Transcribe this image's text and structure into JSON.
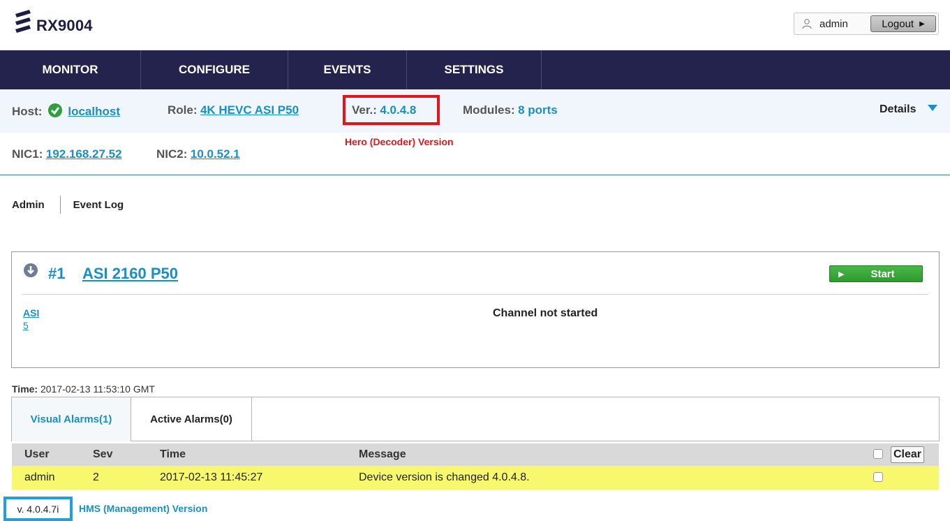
{
  "header": {
    "logo_text": "RX9004",
    "user_name": "admin",
    "logout_label": "Logout",
    "user_icon": "user-icon",
    "logout_arrow_icon": "caret-right-icon"
  },
  "nav": {
    "items": [
      {
        "label": "MONITOR"
      },
      {
        "label": "CONFIGURE"
      },
      {
        "label": "EVENTS"
      },
      {
        "label": "SETTINGS"
      }
    ]
  },
  "info": {
    "host_label": "Host:",
    "host_value": "localhost",
    "role_label": "Role:",
    "role_value": "4K HEVC ASI P50",
    "ver_label": "Ver.:",
    "ver_value": "4.0.4.8",
    "modules_label": "Modules:",
    "modules_value": "8 ports",
    "details_label": "Details",
    "nic1_label": "NIC1:",
    "nic1_value": "192.168.27.52",
    "nic2_label": "NIC2:",
    "nic2_value": "10.0.52.1",
    "hero_note": "Hero (Decoder) Version"
  },
  "subtabs": {
    "admin": "Admin",
    "event_log": "Event Log"
  },
  "channel": {
    "number": "#1",
    "name": "ASI 2160 P50",
    "start_label": "Start",
    "input_link": "ASI",
    "input_num": "5",
    "status": "Channel not started"
  },
  "time": {
    "label": "Time:",
    "value": "2017-02-13 11:53:10 GMT"
  },
  "alarms": {
    "tabs": [
      "Visual Alarms(1)",
      "Active Alarms(0)"
    ],
    "headers": [
      "User",
      "Sev",
      "Time",
      "Message"
    ],
    "clear_label": "Clear",
    "rows": [
      {
        "user": "admin",
        "sev": "2",
        "time": "2017-02-13 11:45:27",
        "message": "Device version is changed 4.0.4.8."
      }
    ]
  },
  "footer": {
    "version": "v. 4.0.4.7i",
    "hms_note": "HMS (Management) Version"
  },
  "colors": {
    "nav_bg": "#23234d",
    "accent": "#1a8fc4",
    "alarm_row": "#f8f86e",
    "annotation_red": "#e0161c",
    "annotation_blue": "#1fa0dd",
    "start_green": "#3aa83a"
  }
}
